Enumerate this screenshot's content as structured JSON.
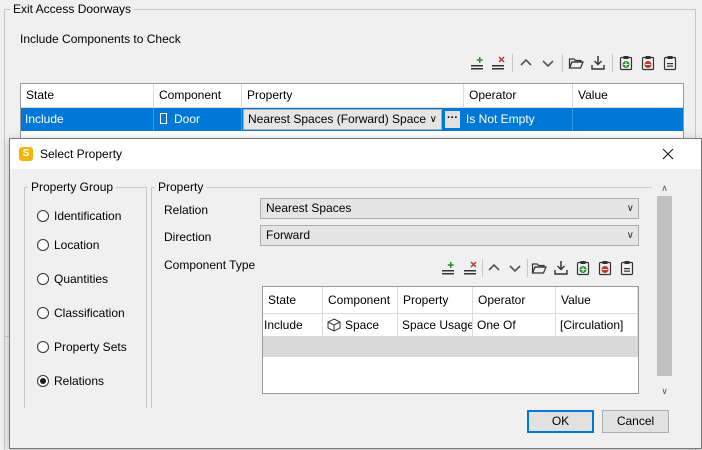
{
  "background": {
    "group_title": "Exit Access Doorways",
    "include_label": "Include Components to Check",
    "toolbar_icons": [
      "add-row-icon",
      "delete-row-icon",
      "move-up-icon",
      "move-down-icon",
      "open-folder-icon",
      "download-icon",
      "add-group-icon",
      "remove-group-icon",
      "clipboard-icon"
    ],
    "table": {
      "headers": [
        "State",
        "Component",
        "Property",
        "Operator",
        "Value"
      ],
      "row": {
        "state": "Include",
        "component": "Door",
        "property": "Nearest Spaces (Forward) Space",
        "operator": "Is Not Empty",
        "value": ""
      }
    }
  },
  "dialog": {
    "title": "Select Property",
    "app_icon_letter": "S",
    "property_group": {
      "title": "Property Group",
      "options": [
        "Identification",
        "Location",
        "Quantities",
        "Classification",
        "Property Sets",
        "Relations"
      ],
      "selected": "Relations"
    },
    "property": {
      "title": "Property",
      "relation_label": "Relation",
      "relation_value": "Nearest Spaces",
      "direction_label": "Direction",
      "direction_value": "Forward",
      "component_type_label": "Component Type",
      "table": {
        "headers": [
          "State",
          "Component",
          "Property",
          "Operator",
          "Value"
        ],
        "row": {
          "state": "Include",
          "component": "Space",
          "property": "Space Usage",
          "operator": "One Of",
          "value": "[Circulation]"
        }
      }
    },
    "ok_label": "OK",
    "cancel_label": "Cancel"
  },
  "colors": {
    "selection": "#0078d7",
    "accent_green": "#2e8b2e",
    "accent_red": "#c0392b"
  }
}
